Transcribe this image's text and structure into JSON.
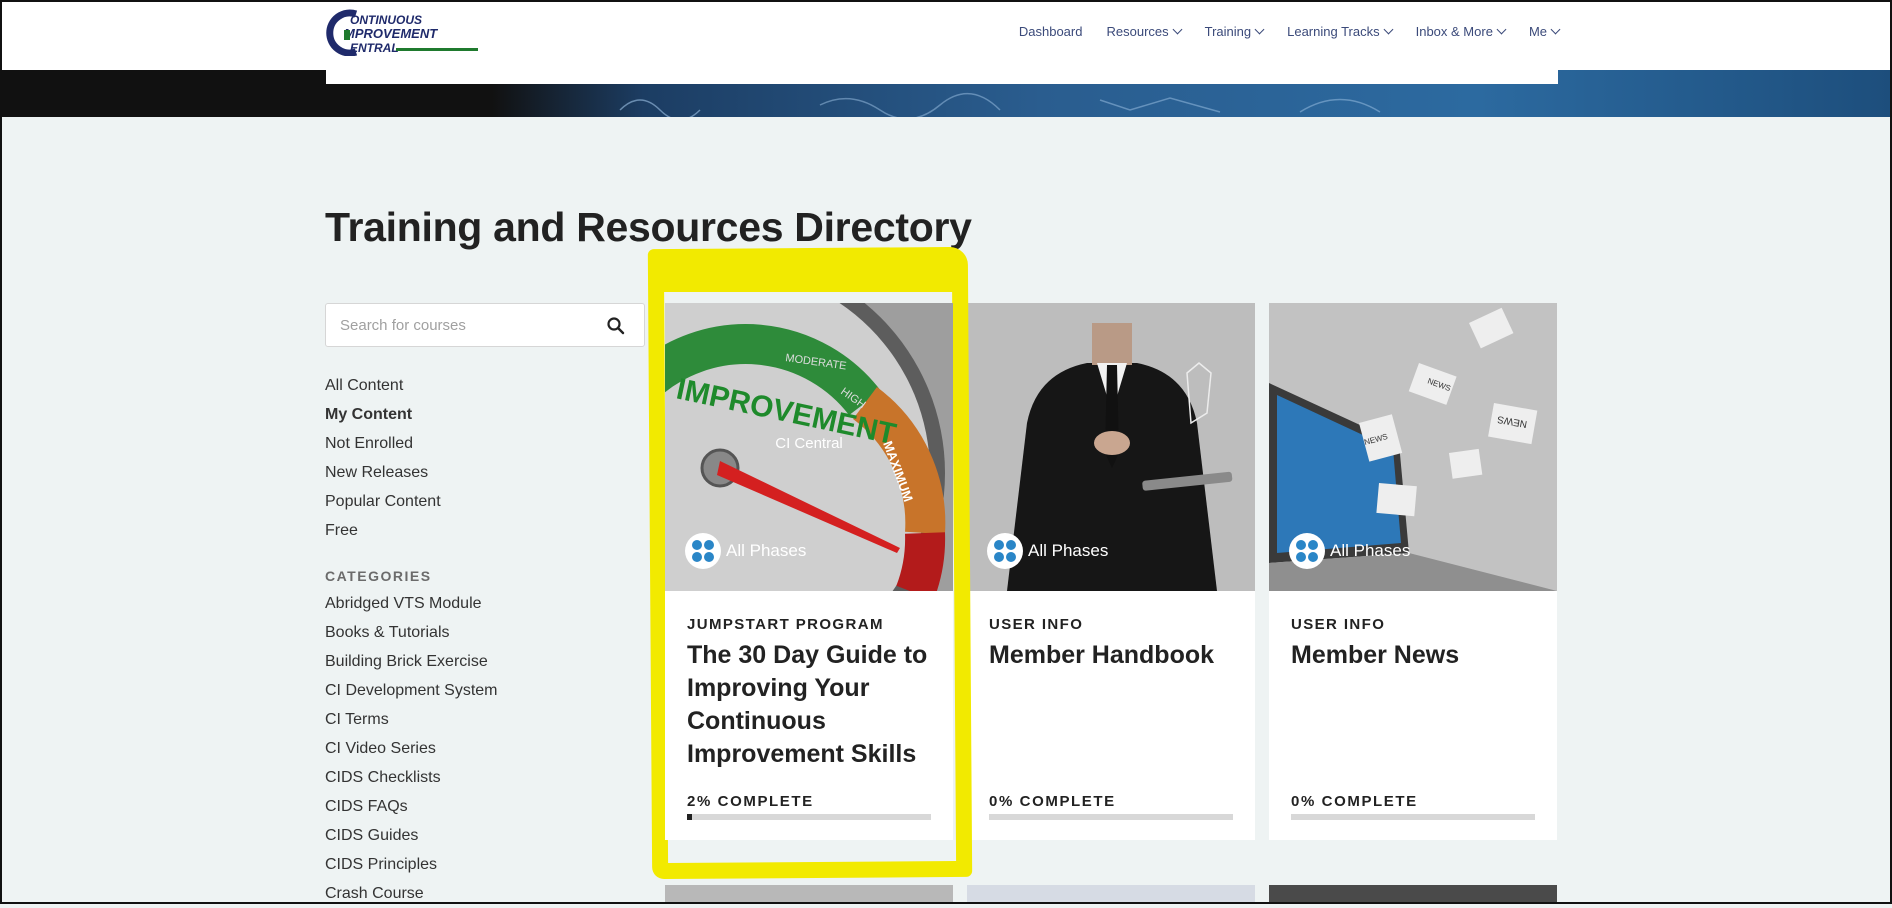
{
  "brand": {
    "logo_line1": "ONTINUOUS",
    "logo_line2": "MPROVEMENT",
    "logo_line3": "ENTRAL",
    "colors": {
      "navy": "#1f2a6b",
      "green": "#1f7a2e",
      "highlight": "#f2ea00"
    }
  },
  "nav": {
    "dashboard": "Dashboard",
    "resources": "Resources",
    "training": "Training",
    "learning_tracks": "Learning Tracks",
    "inbox": "Inbox & More",
    "me": "Me"
  },
  "page": {
    "title": "Training and Resources Directory"
  },
  "search": {
    "placeholder": "Search for courses"
  },
  "filters": [
    "All Content",
    "My Content",
    "Not Enrolled",
    "New Releases",
    "Popular Content",
    "Free"
  ],
  "active_filter": "My Content",
  "categories": {
    "heading": "CATEGORIES",
    "items": [
      "Abridged VTS Module",
      "Books & Tutorials",
      "Building Brick Exercise",
      "CI Development System",
      "CI Terms",
      "CI Video Series",
      "CIDS Checklists",
      "CIDS FAQs",
      "CIDS Guides",
      "CIDS Principles",
      "Crash Course"
    ]
  },
  "cards": [
    {
      "image_caption": "CI Central",
      "phase": "All Phases",
      "category": "JUMPSTART PROGRAM",
      "title": "The 30 Day Guide to Improving Your Continuous Improvement Skills",
      "progress_label": "2% COMPLETE",
      "progress": 0.02,
      "image_icon": "improvement-gauge",
      "gauge_labels": [
        "IMPROVEMENT",
        "MODERATE",
        "HIGH",
        "MAXIMUM"
      ]
    },
    {
      "image_caption": "",
      "phase": "All Phases",
      "category": "USER INFO",
      "title": "Member Handbook",
      "progress_label": "0% COMPLETE",
      "progress": 0,
      "image_icon": "businessman-tablet"
    },
    {
      "image_caption": "",
      "phase": "All Phases",
      "category": "USER INFO",
      "title": "Member News",
      "progress_label": "0% COMPLETE",
      "progress": 0,
      "image_icon": "laptop-news",
      "news_words": [
        "NEWS",
        "NEWS",
        "NEWS"
      ]
    }
  ]
}
